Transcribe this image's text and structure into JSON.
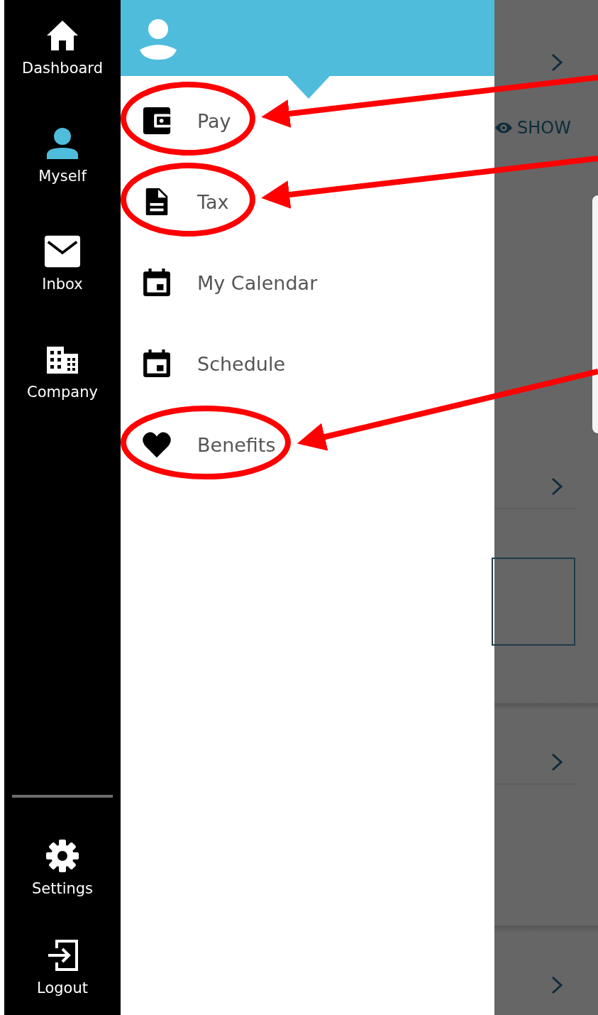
{
  "rail": {
    "top_items": [
      {
        "label": "Dashboard",
        "kind": "home",
        "selected": false
      },
      {
        "label": "Myself",
        "kind": "person",
        "selected": true
      },
      {
        "label": "Inbox",
        "kind": "mail",
        "selected": false
      },
      {
        "label": "Company",
        "kind": "building",
        "selected": false
      }
    ],
    "bottom_items": [
      {
        "label": "Settings",
        "kind": "gear",
        "selected": false
      },
      {
        "label": "Logout",
        "kind": "logout",
        "selected": false
      }
    ]
  },
  "drawer": {
    "menu": [
      {
        "label": "Pay",
        "kind": "wallet",
        "highlighted": true
      },
      {
        "label": "Tax",
        "kind": "document",
        "highlighted": true
      },
      {
        "label": "My Calendar",
        "kind": "calendar",
        "highlighted": false
      },
      {
        "label": "Schedule",
        "kind": "calendar",
        "highlighted": false
      },
      {
        "label": "Benefits",
        "kind": "heart",
        "highlighted": true
      }
    ]
  },
  "background": {
    "show_label": "SHOW"
  }
}
